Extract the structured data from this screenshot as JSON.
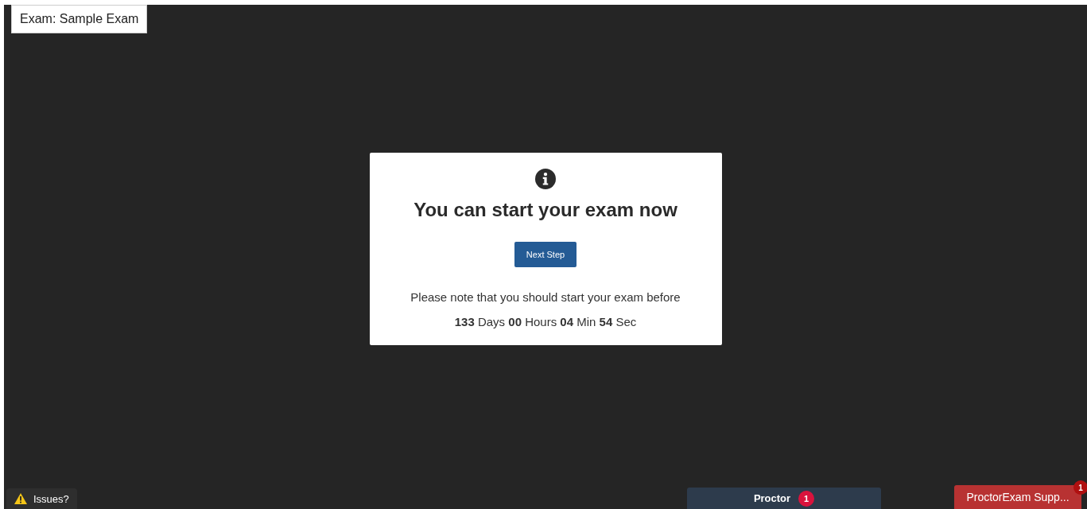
{
  "exam_label": "Exam: Sample Exam",
  "dialog": {
    "title": "You can start your exam now",
    "button": "Next Step",
    "note": "Please note that you should start your exam before",
    "countdown": "**133** Days **00** Hours **04** Min **54** Sec"
  },
  "bottom_bar": {
    "issues": "Issues?",
    "tabs": [
      {
        "kind": "proctor",
        "label": "Proctor",
        "badge": "1"
      },
      {
        "kind": "support",
        "label": "ProctorExam Supp...",
        "badge": "1"
      }
    ]
  }
}
